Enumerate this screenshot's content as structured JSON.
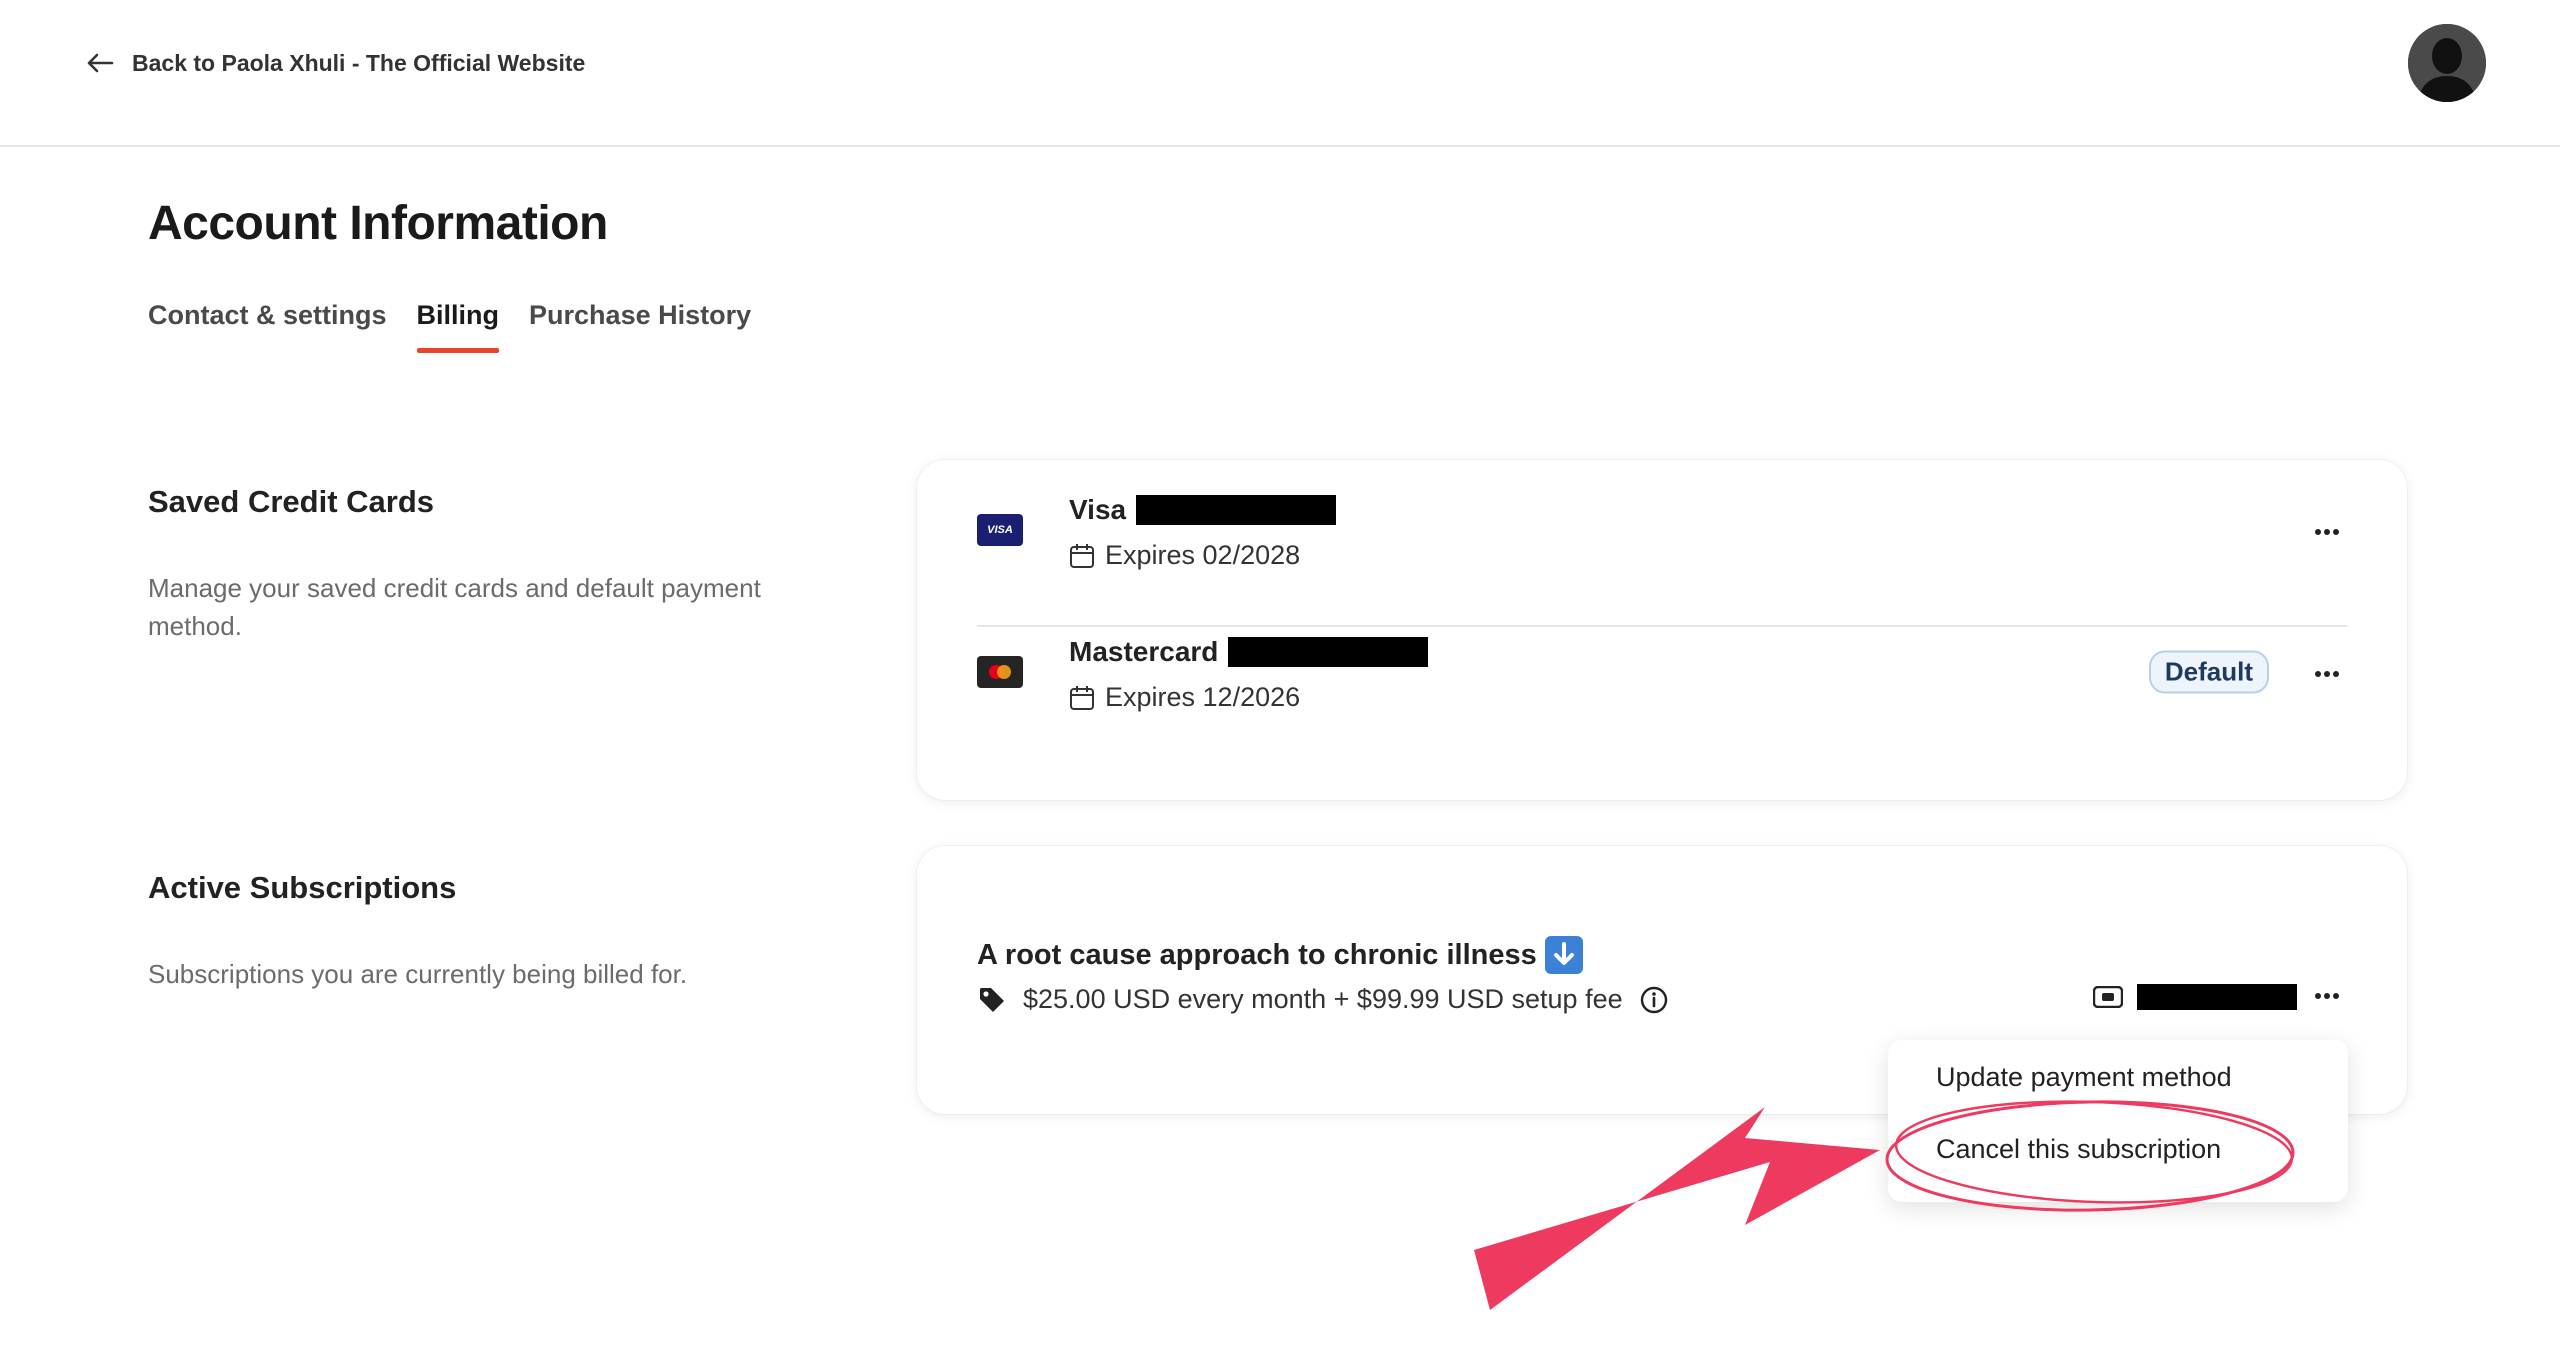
{
  "header": {
    "back_label": "Back to Paola Xhuli - The Official Website"
  },
  "page": {
    "title": "Account Information",
    "tabs": [
      {
        "label": "Contact & settings",
        "active": false
      },
      {
        "label": "Billing",
        "active": true
      },
      {
        "label": "Purchase History",
        "active": false
      }
    ]
  },
  "saved_cards": {
    "title": "Saved Credit Cards",
    "description": "Manage your saved credit cards and default payment method.",
    "cards": [
      {
        "brand": "Visa",
        "logo_text": "VISA",
        "expires": "Expires 02/2028",
        "default": false
      },
      {
        "brand": "Mastercard",
        "expires": "Expires 12/2026",
        "default": true
      }
    ],
    "default_label": "Default"
  },
  "subscriptions": {
    "title": "Active Subscriptions",
    "description": "Subscriptions you are currently being billed for.",
    "item": {
      "name": "A root cause approach to chronic illness",
      "price": "$25.00 USD every month + $99.99 USD setup fee"
    }
  },
  "menu": {
    "update_payment": "Update payment method",
    "cancel_subscription": "Cancel this subscription"
  },
  "colors": {
    "accent": "#e8442c",
    "annotation": "#ee3a5f",
    "default_badge_bg": "#eef4fb"
  },
  "icons": [
    "arrow-left-icon",
    "calendar-icon",
    "more-horizontal-icon",
    "tag-icon",
    "info-icon",
    "card-icon",
    "down-arrow-emoji-icon"
  ]
}
